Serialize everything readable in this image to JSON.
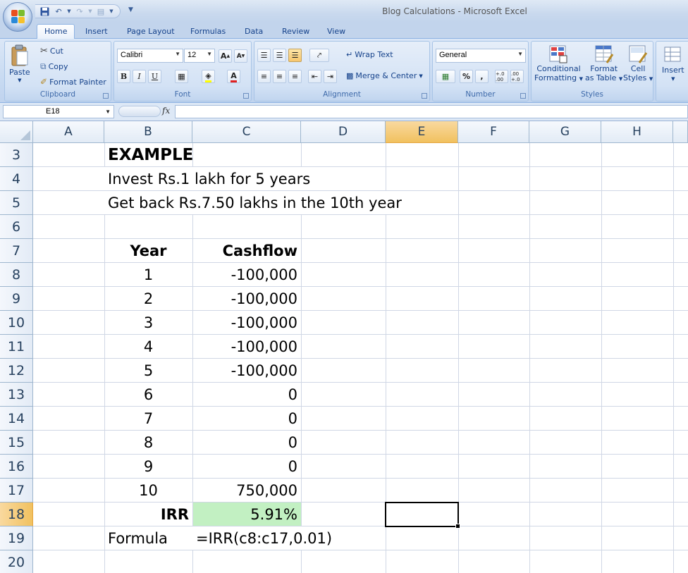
{
  "window": {
    "title": "Blog Calculations - Microsoft Excel"
  },
  "quick_access": {
    "icons": [
      "save-icon",
      "undo-icon",
      "redo-icon",
      "print-preview-icon",
      "customize-icon"
    ]
  },
  "tabs": [
    "Home",
    "Insert",
    "Page Layout",
    "Formulas",
    "Data",
    "Review",
    "View"
  ],
  "active_tab": "Home",
  "ribbon": {
    "clipboard": {
      "label": "Clipboard",
      "paste": "Paste",
      "cut": "Cut",
      "copy": "Copy",
      "format_painter": "Format Painter"
    },
    "font": {
      "label": "Font",
      "font_name": "Calibri",
      "font_size": "12",
      "bold": "B",
      "italic": "I",
      "underline": "U",
      "font_color": "A"
    },
    "alignment": {
      "label": "Alignment",
      "wrap_text": "Wrap Text",
      "merge_center": "Merge & Center"
    },
    "number": {
      "label": "Number",
      "format": "General",
      "percent": "%",
      "comma": ",",
      "inc_decimal": "+.0 .00",
      "dec_decimal": ".00 +.0"
    },
    "styles": {
      "label": "Styles",
      "conditional_1": "Conditional",
      "conditional_2": "Formatting",
      "format_table_1": "Format",
      "format_table_2": "as Table",
      "cell_styles_1": "Cell",
      "cell_styles_2": "Styles"
    },
    "cells": {
      "insert": "Insert"
    }
  },
  "formula_bar": {
    "name_box": "E18",
    "fx": "fx",
    "formula": ""
  },
  "columns": [
    "A",
    "B",
    "C",
    "D",
    "E",
    "F",
    "G",
    "H"
  ],
  "selected_column": "E",
  "rows": [
    "3",
    "4",
    "5",
    "6",
    "7",
    "8",
    "9",
    "10",
    "11",
    "12",
    "13",
    "14",
    "15",
    "16",
    "17",
    "18",
    "19",
    "20"
  ],
  "selected_row": "18",
  "sheet": {
    "b3": "EXAMPLE",
    "b4": "Invest Rs.1 lakh for 5 years",
    "b5": "Get back Rs.7.50 lakhs in the 10th year",
    "b7": "Year",
    "c7": "Cashflow",
    "table": [
      {
        "year": "1",
        "cashflow": "-100,000"
      },
      {
        "year": "2",
        "cashflow": "-100,000"
      },
      {
        "year": "3",
        "cashflow": "-100,000"
      },
      {
        "year": "4",
        "cashflow": "-100,000"
      },
      {
        "year": "5",
        "cashflow": "-100,000"
      },
      {
        "year": "6",
        "cashflow": "0"
      },
      {
        "year": "7",
        "cashflow": "0"
      },
      {
        "year": "8",
        "cashflow": "0"
      },
      {
        "year": "9",
        "cashflow": "0"
      },
      {
        "year": "10",
        "cashflow": "750,000"
      }
    ],
    "b18": "IRR",
    "c18": "5.91%",
    "b19": "Formula",
    "c19": "=IRR(c8:c17,0.01)"
  },
  "colors": {
    "irr_fill": "#c2f0c2",
    "selection_header": "#f1c15f"
  }
}
